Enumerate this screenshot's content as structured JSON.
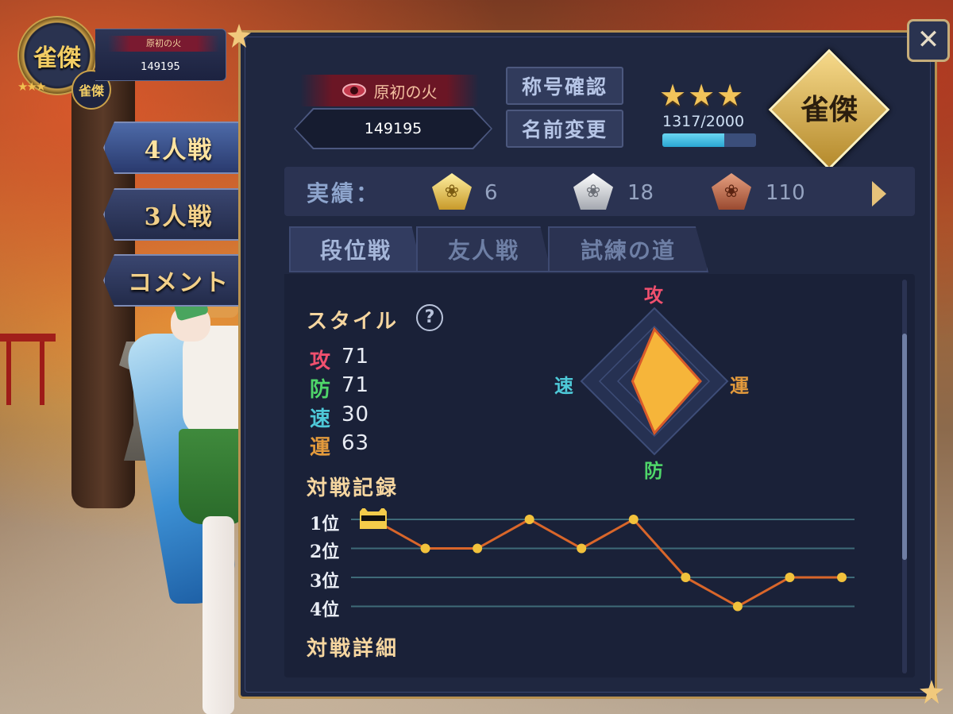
{
  "player": {
    "avatar_text": "雀傑",
    "title": "原初の火",
    "score": "149195"
  },
  "side_menu": [
    {
      "label": "4人戦",
      "active": true
    },
    {
      "label": "3人戦",
      "active": false
    },
    {
      "label": "コメント",
      "active": false
    }
  ],
  "profile": {
    "title": "原初の火",
    "score": "149195",
    "btn_title_check": "称号確認",
    "btn_rename": "名前変更",
    "stars": "★★★",
    "exp_text": "1317/2000",
    "exp_current": 1317,
    "exp_max": 2000,
    "rank_text": "雀傑"
  },
  "achievements": {
    "label": "実績：",
    "gold": "6",
    "silver": "18",
    "bronze": "110"
  },
  "tabs": [
    {
      "label": "段位戦",
      "active": true
    },
    {
      "label": "友人戦",
      "active": false
    },
    {
      "label": "試練の道",
      "active": false
    }
  ],
  "style": {
    "title": "スタイル",
    "help": "?",
    "stats": [
      {
        "key": "攻",
        "value": "71",
        "color": "#f0506e"
      },
      {
        "key": "防",
        "value": "71",
        "color": "#4fd66a"
      },
      {
        "key": "速",
        "value": "30",
        "color": "#4ec9d8"
      },
      {
        "key": "運",
        "value": "63",
        "color": "#e39a3c"
      }
    ],
    "radar_labels": {
      "top": "攻",
      "right": "運",
      "bottom": "防",
      "left": "速"
    }
  },
  "record": {
    "title": "対戦記録",
    "rank_labels": [
      "1位",
      "2位",
      "3位",
      "4位"
    ]
  },
  "detail": {
    "title": "対戦詳細"
  },
  "chart_data": {
    "type": "line",
    "title": "対戦記録",
    "xlabel": "",
    "ylabel": "",
    "y_categories": [
      "1位",
      "2位",
      "3位",
      "4位"
    ],
    "series": [
      {
        "values": [
          1,
          2,
          2,
          1,
          2,
          1,
          3,
          4,
          3,
          3
        ]
      }
    ],
    "line_color": "#d9662a",
    "point_color": "#f2c23c",
    "grid": true
  },
  "close": "✕"
}
